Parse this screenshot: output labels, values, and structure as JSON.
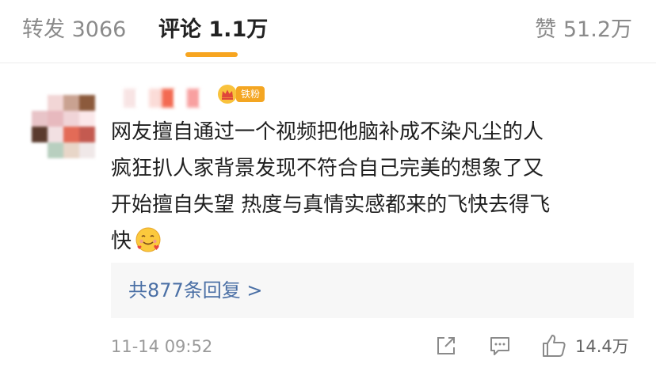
{
  "tabs": {
    "repost": "转发 3066",
    "comment": "评论 1.1万",
    "like": "赞 51.2万",
    "active_color": "#f7a520"
  },
  "comment": {
    "badge_label": "铁粉",
    "badge_color": "#f4a622",
    "content_lines": [
      "网友擅自通过一个视频把他脑补成不染凡尘的人",
      "疯狂扒人家背景发现不符合自己完美的想象了又",
      "开始擅自失望 热度与真情实感都来的飞快去得飞",
      "快"
    ],
    "emoji": "smiling-face-with-hearts-icon",
    "replies_link": "共877条回复 >",
    "timestamp": "11-14 09:52",
    "like_count": "14.4万"
  },
  "icons": {
    "share": "share-icon",
    "reply": "comment-icon",
    "like": "thumbs-up-icon"
  }
}
